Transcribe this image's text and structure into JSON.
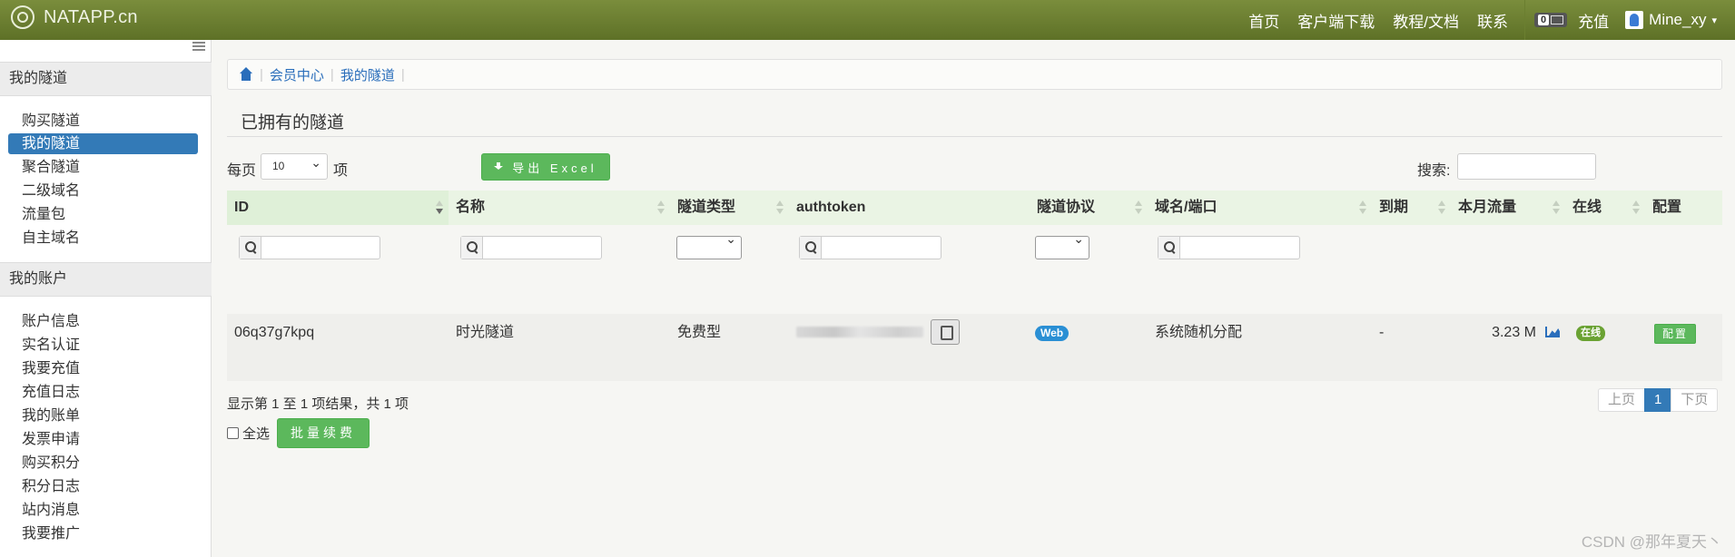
{
  "navbar": {
    "brand": "NATAPP.cn",
    "links": [
      "首页",
      "客户端下载",
      "教程/文档",
      "联系"
    ],
    "msg_count": "0",
    "recharge": "充值",
    "username": "Mine_xy",
    "caret": "▾"
  },
  "sidebar": {
    "section1_title": "我的隧道",
    "section1_items": [
      "购买隧道",
      "我的隧道",
      "聚合隧道",
      "二级域名",
      "流量包",
      "自主域名"
    ],
    "section2_title": "我的账户",
    "section2_items": [
      "账户信息",
      "实名认证",
      "我要充值",
      "充值日志",
      "我的账单",
      "发票申请",
      "购买积分",
      "积分日志",
      "站内消息",
      "我要推广"
    ]
  },
  "breadcrumb": {
    "items": [
      "会员中心",
      "我的隧道"
    ]
  },
  "page_title": "已拥有的隧道",
  "controls": {
    "per_page_label": "每页",
    "per_page_value": "10",
    "per_page_suffix": "项",
    "export_label": "导出 Excel",
    "search_label": "搜索:"
  },
  "table": {
    "columns": [
      "ID",
      "名称",
      "隧道类型",
      "authtoken",
      "隧道协议",
      "域名/端口",
      "到期",
      "本月流量",
      "在线",
      "配置"
    ],
    "rows": [
      {
        "id": "06q37g7kpq",
        "name": "时光隧道",
        "type": "免费型",
        "protocol": "Web",
        "domain": "系统随机分配",
        "expire": "-",
        "traffic": "3.23 M",
        "online": "在线",
        "config": "配置"
      }
    ]
  },
  "footer": {
    "info": "显示第 1 至 1 项结果，共 1 项",
    "select_all": "全选",
    "renew": "批量续费",
    "pager": [
      "上页",
      "1",
      "下页"
    ]
  },
  "watermark": "CSDN @那年夏天丶"
}
